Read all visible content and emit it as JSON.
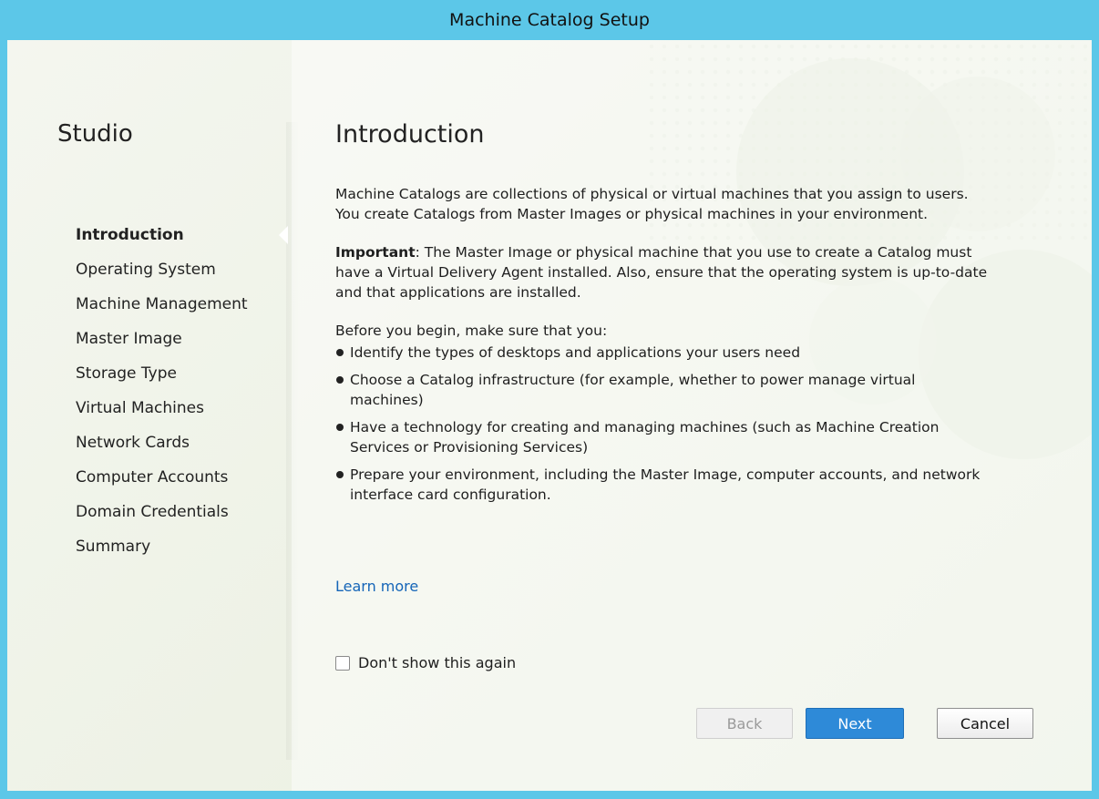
{
  "window": {
    "title": "Machine Catalog Setup"
  },
  "sidebar": {
    "heading": "Studio",
    "steps": [
      {
        "label": "Introduction",
        "active": true
      },
      {
        "label": "Operating System"
      },
      {
        "label": "Machine Management"
      },
      {
        "label": "Master Image"
      },
      {
        "label": "Storage Type"
      },
      {
        "label": "Virtual Machines"
      },
      {
        "label": "Network Cards"
      },
      {
        "label": "Computer Accounts"
      },
      {
        "label": "Domain Credentials"
      },
      {
        "label": "Summary"
      }
    ]
  },
  "main": {
    "title": "Introduction",
    "intro": "Machine Catalogs are collections of physical or virtual machines that you assign to users. You create Catalogs from Master Images or physical machines in your environment.",
    "important_label": "Important",
    "important_text": ": The Master Image or physical machine that you use to create a Catalog must have a Virtual Delivery Agent installed. Also, ensure that the operating system is up-to-date and that applications are installed.",
    "before_text": "Before you begin, make sure that you:",
    "bullets": [
      "Identify the types of desktops and applications your users need",
      "Choose a Catalog infrastructure (for example, whether to power manage virtual machines)",
      "Have a technology for creating and managing machines (such as Machine Creation Services or Provisioning Services)",
      "Prepare your environment, including the Master Image, computer accounts, and network interface card configuration."
    ],
    "learn_more": "Learn more",
    "dont_show": "Don't show this again",
    "dont_show_checked": false
  },
  "buttons": {
    "back": "Back",
    "next": "Next",
    "cancel": "Cancel"
  },
  "colors": {
    "title_bar": "#5cc7e8",
    "link": "#1565b8",
    "primary_button": "#2e8ad8"
  }
}
